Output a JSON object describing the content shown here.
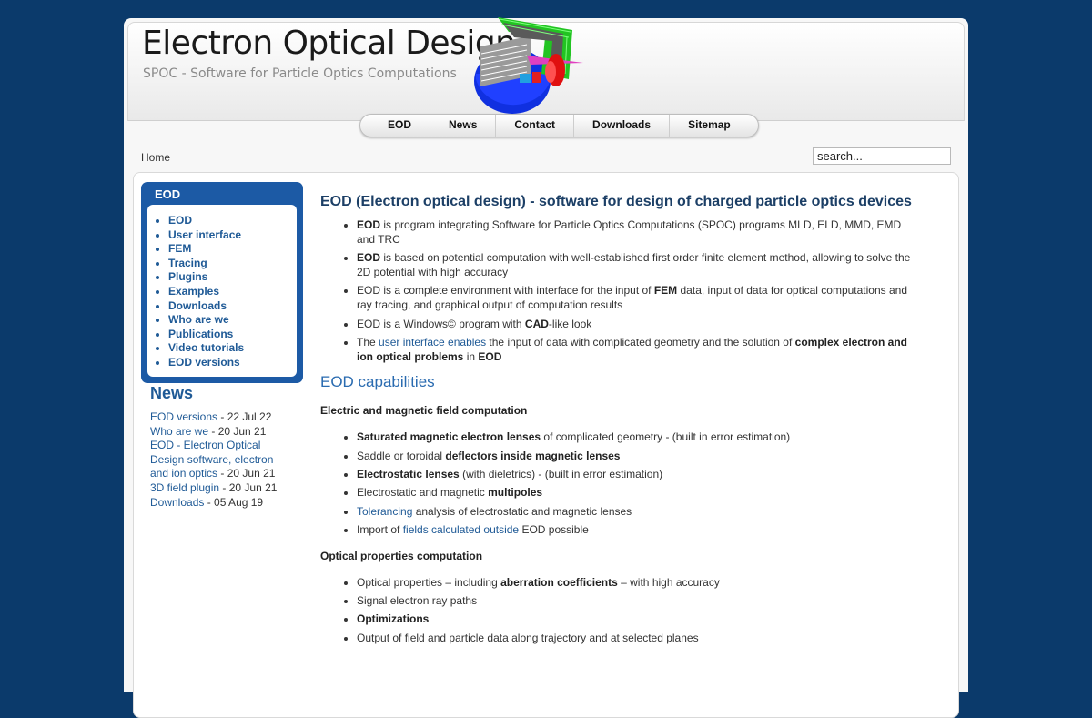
{
  "site": {
    "title": "Electron Optical Design",
    "slogan": "SPOC - Software for Particle Optics Computations"
  },
  "nav": [
    "EOD",
    "News",
    "Contact",
    "Downloads",
    "Sitemap"
  ],
  "breadcrumb": "Home",
  "search": {
    "value": "search..."
  },
  "sidebar": {
    "title": "EOD",
    "items": [
      "EOD",
      "User interface",
      "FEM",
      "Tracing",
      "Plugins",
      "Examples",
      "Downloads",
      "Who are we",
      "Publications",
      "Video tutorials",
      "EOD versions"
    ]
  },
  "news": {
    "title": "News",
    "entries": [
      {
        "link": "EOD versions",
        "date": " - 22 Jul 22"
      },
      {
        "link": "Who are we",
        "date": " - 20 Jun 21"
      },
      {
        "link": "EOD - Electron Optical Design software, electron and ion optics",
        "date": " - 20 Jun 21"
      },
      {
        "link": "3D field plugin",
        "date": " - 20 Jun 21"
      },
      {
        "link": "Downloads",
        "date": " - 05 Aug 19"
      }
    ]
  },
  "main": {
    "title": "EOD (Electron optical design) - software for design of charged particle optics devices",
    "intro": [
      {
        "b1": "EOD",
        "t1": " is program integrating Software for Particle Optics Computations (SPOC) programs MLD, ELD, MMD, EMD and TRC"
      },
      {
        "b1": "EOD",
        "t1": " is based on potential computation with well-established first order finite element method, allowing to solve the 2D potential with high accuracy"
      },
      {
        "t1": "EOD is a complete environment with interface for the input of ",
        "b1": "FEM",
        "t2": " data, input of data for optical computations and ray tracing, and graphical output of computation results"
      },
      {
        "t1": "EOD is a Windows© program with ",
        "b1": "CAD",
        "t2": "-like look"
      },
      {
        "t1": "The ",
        "link": "user interface enables",
        "t2": " the input of data with complicated geometry and the solution of ",
        "b1": "complex electron and ion optical problems",
        "t3": " in ",
        "b2": "EOD"
      }
    ],
    "capabilities_title": "EOD capabilities",
    "field_title": "Electric and magnetic field computation",
    "field_items": [
      {
        "b1": "Saturated magnetic electron lenses",
        "t1": " of complicated geometry - (built in error estimation)"
      },
      {
        "t1": "Saddle or toroidal ",
        "b1": "deflectors inside magnetic lenses"
      },
      {
        "b1": "Electrostatic lenses",
        "t1": " (with dieletrics) - (built in error estimation)"
      },
      {
        "t1": "Electrostatic and magnetic ",
        "b1": "multipoles"
      },
      {
        "link": "Tolerancing",
        "t1": " analysis of electrostatic and magnetic lenses"
      },
      {
        "t1": "Import of ",
        "link": "fields calculated outside",
        "t2": " EOD possible"
      }
    ],
    "optical_title": "Optical properties computation",
    "optical_items": [
      {
        "t1": "Optical properties – including ",
        "b1": "aberration coefficients",
        "t2": " – with high accuracy"
      },
      {
        "t1": "Signal electron ray paths"
      },
      {
        "b1": "Optimizations"
      },
      {
        "t1": "Output of field and particle data along trajectory and at selected planes"
      }
    ]
  }
}
